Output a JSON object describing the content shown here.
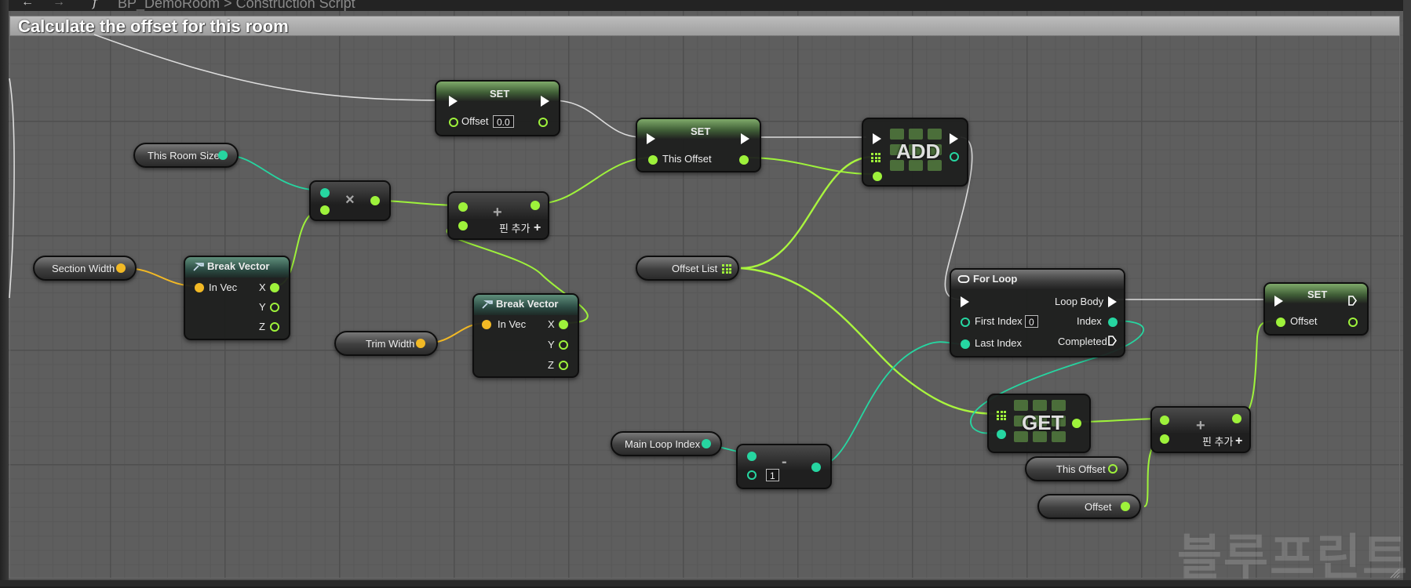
{
  "toolbar": {
    "back_icon": "arrow-left-icon",
    "forward_icon": "arrow-right-icon",
    "function_icon": "function-icon",
    "breadcrumb": "BP_DemoRoom > Construction Script"
  },
  "comment": {
    "title": "Calculate the offset for this room",
    "color": "#b0b0b0"
  },
  "nodes": {
    "set_offset": {
      "title": "SET",
      "pin_label": "Offset",
      "default_value": "0.0"
    },
    "set_this_offset": {
      "title": "SET",
      "pin_label": "This Offset"
    },
    "add_array": {
      "label": "ADD"
    },
    "this_room_size": {
      "label": "This Room Size"
    },
    "multiply": {
      "symbol": "×"
    },
    "add_float_top": {
      "symbol": "+",
      "add_pin": "핀 추가"
    },
    "section_width": {
      "label": "Section Width"
    },
    "break_vector_1": {
      "title": "Break Vector",
      "in_label": "In Vec",
      "x": "X",
      "y": "Y",
      "z": "Z"
    },
    "trim_width": {
      "label": "Trim Width"
    },
    "break_vector_2": {
      "title": "Break Vector",
      "in_label": "In Vec",
      "x": "X",
      "y": "Y",
      "z": "Z"
    },
    "offset_list": {
      "label": "Offset List"
    },
    "for_loop": {
      "title": "For Loop",
      "loop_body": "Loop Body",
      "first_index": "First Index",
      "first_index_value": "0",
      "index": "Index",
      "last_index": "Last Index",
      "completed": "Completed"
    },
    "set_offset_2": {
      "title": "SET",
      "pin_label": "Offset"
    },
    "main_loop_index": {
      "label": "Main Loop Index"
    },
    "subtract": {
      "symbol": "-",
      "value": "1"
    },
    "get_array": {
      "label": "GET"
    },
    "add_float_bottom": {
      "symbol": "+",
      "add_pin": "핀 추가"
    },
    "this_offset_getter": {
      "label": "This Offset"
    },
    "offset_getter": {
      "label": "Offset"
    }
  },
  "watermark": "블루프린트",
  "colors": {
    "vector": "#f2b925",
    "float": "#9ef23b",
    "integer": "#26d6a1",
    "exec": "#ffffff"
  }
}
